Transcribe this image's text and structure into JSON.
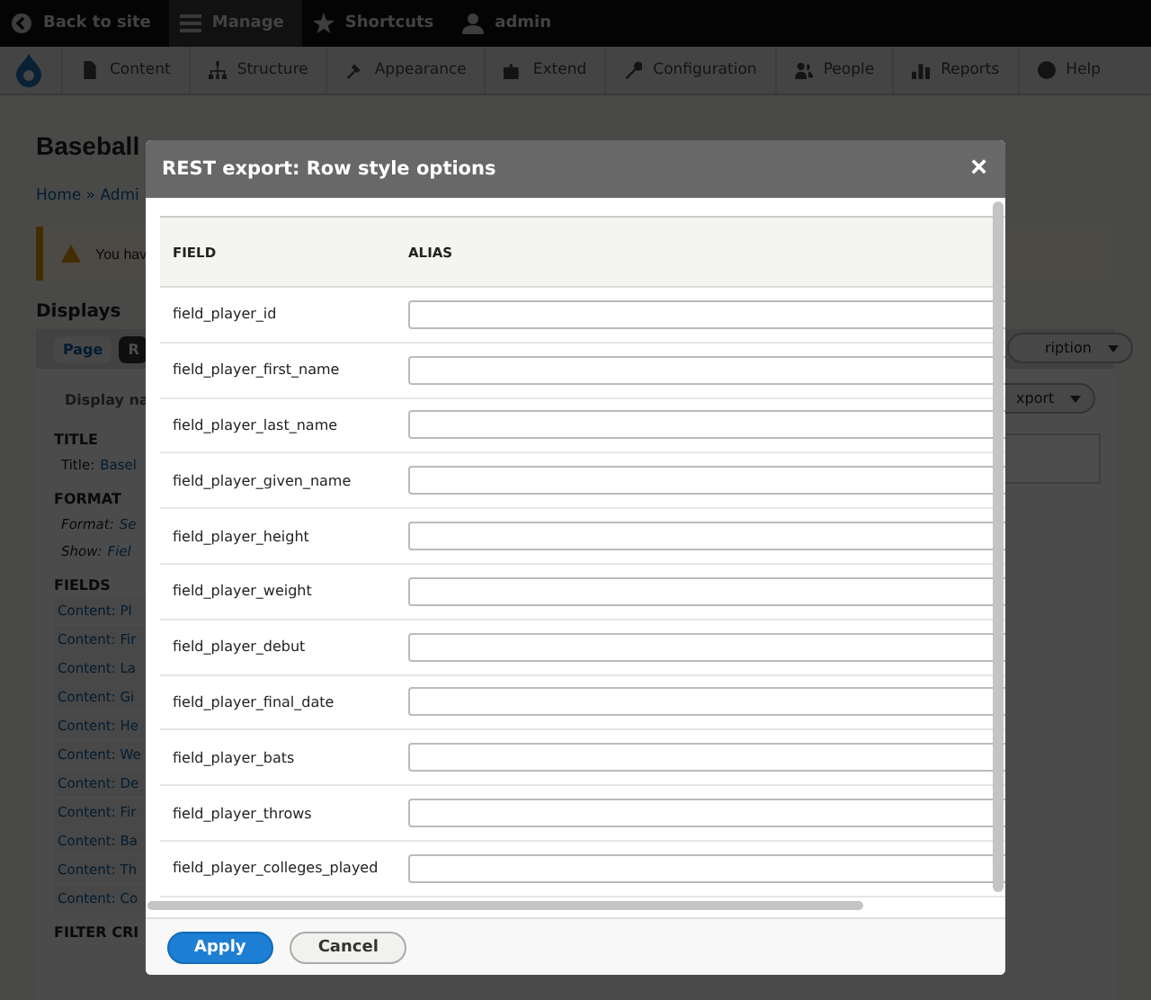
{
  "toolbar": {
    "items": [
      {
        "label": "Back to site",
        "selected": false
      },
      {
        "label": "Manage",
        "selected": true
      },
      {
        "label": "Shortcuts",
        "selected": false
      },
      {
        "label": "admin",
        "selected": false
      }
    ]
  },
  "menu": {
    "items": [
      "Content",
      "Structure",
      "Appearance",
      "Extend",
      "Configuration",
      "People",
      "Reports",
      "Help"
    ]
  },
  "page": {
    "title": "Baseball",
    "breadcrumb": "Home » Admi",
    "warning": "You hav",
    "displays_heading": "Displays",
    "tabs": [
      {
        "label": "Page",
        "selected": false
      },
      {
        "label": "R",
        "selected": true
      }
    ],
    "display_name_label": "Display na",
    "right_buttons": [
      "ription",
      "xport"
    ],
    "sections": [
      {
        "heading": "TITLE",
        "rows": [
          {
            "label": "Title:",
            "value": "Basel",
            "kind": "setting"
          }
        ]
      },
      {
        "heading": "FORMAT",
        "rows": [
          {
            "label": "Format:",
            "value": "Se",
            "kind": "option"
          },
          {
            "label": "Show:",
            "value": "Fiel",
            "kind": "option"
          }
        ]
      },
      {
        "heading": "FIELDS",
        "links": [
          "Content: Pl",
          "Content: Fir",
          "Content: La",
          "Content: Gi",
          "Content: He",
          "Content: We",
          "Content: De",
          "Content: Fir",
          "Content: Ba",
          "Content: Th",
          "Content: Co"
        ]
      },
      {
        "heading": "FILTER CRI"
      }
    ]
  },
  "dialog": {
    "title": "REST export: Row style options",
    "close": "×",
    "columns": [
      "FIELD",
      "ALIAS"
    ],
    "rows": [
      {
        "field": "field_player_id"
      },
      {
        "field": "field_player_first_name"
      },
      {
        "field": "field_player_last_name"
      },
      {
        "field": "field_player_given_name"
      },
      {
        "field": "field_player_height"
      },
      {
        "field": "field_player_weight"
      },
      {
        "field": "field_player_debut"
      },
      {
        "field": "field_player_final_date"
      },
      {
        "field": "field_player_bats"
      },
      {
        "field": "field_player_throws"
      },
      {
        "field": "field_player_colleges_played"
      }
    ],
    "buttons": [
      {
        "label": "Apply",
        "kind": "primary"
      },
      {
        "label": "Cancel",
        "kind": "secondary"
      }
    ]
  }
}
